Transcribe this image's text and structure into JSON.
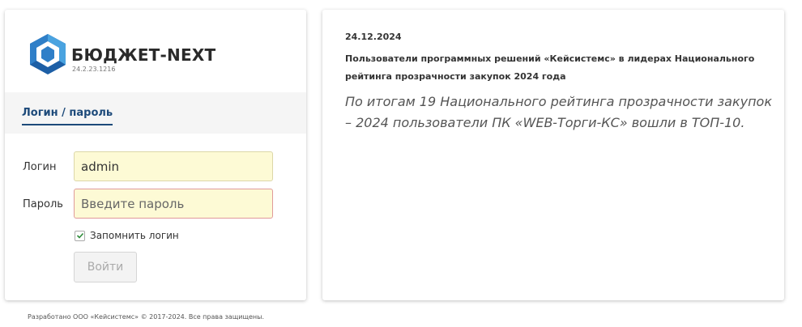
{
  "brand": {
    "name": "БЮДЖЕТ-NEXT",
    "version": "24.2.23.1216",
    "colors": {
      "logo_light": "#4aa3e0",
      "logo_dark": "#1d5fa6"
    }
  },
  "auth": {
    "tab_label": "Логин / пароль",
    "login_label": "Логин",
    "login_value": "admin",
    "password_label": "Пароль",
    "password_placeholder": "Введите пароль",
    "remember_label": "Запомнить логин",
    "remember_checked": true,
    "submit_label": "Войти"
  },
  "news": {
    "date": "24.12.2024",
    "title": "Пользователи программных решений «Кейсистемс» в лидерах Национального рейтинга прозрачности закупок 2024 года",
    "body": "По итогам 19 Национального рейтинга прозрачности закупок – 2024 пользователи ПК «WEB-Торги-КС» вошли в ТОП-10."
  },
  "footer": {
    "text": "Разработано ООО «Кейсистемс» © 2017-2024. Все права защищены."
  }
}
